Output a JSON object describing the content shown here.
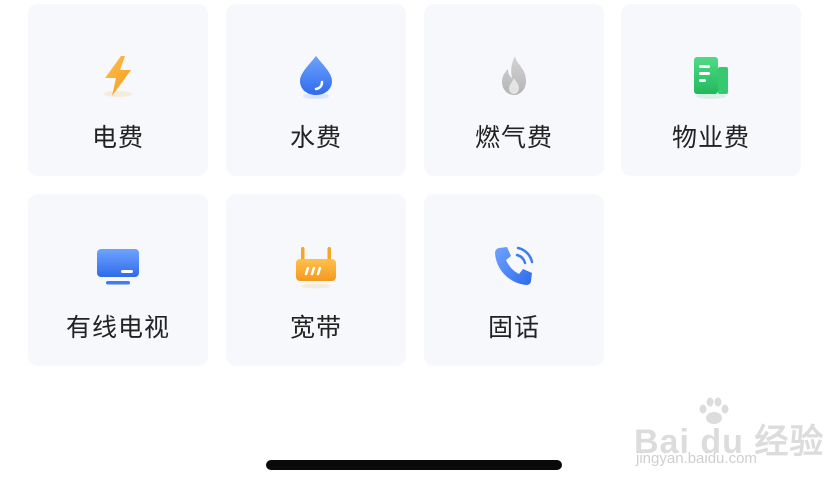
{
  "services": {
    "items": [
      {
        "label": "电费",
        "icon": "lightning-icon",
        "color": "#F5A623"
      },
      {
        "label": "水费",
        "icon": "water-drop-icon",
        "color": "#3D7CF5"
      },
      {
        "label": "燃气费",
        "icon": "flame-icon",
        "color": "#BDBDBD"
      },
      {
        "label": "物业费",
        "icon": "building-icon",
        "color": "#2FCB6B"
      },
      {
        "label": "有线电视",
        "icon": "tv-icon",
        "color": "#3D7CF5"
      },
      {
        "label": "宽带",
        "icon": "router-icon",
        "color": "#F5A623"
      },
      {
        "label": "固话",
        "icon": "phone-icon",
        "color": "#3D7CF5"
      }
    ]
  },
  "watermark": {
    "brand": "Bai du 经验",
    "url": "jingyan.baidu.com"
  },
  "colors": {
    "tile_background": "#F6F8FC",
    "label_text": "#222222",
    "home_indicator": "#0A0A0A"
  }
}
